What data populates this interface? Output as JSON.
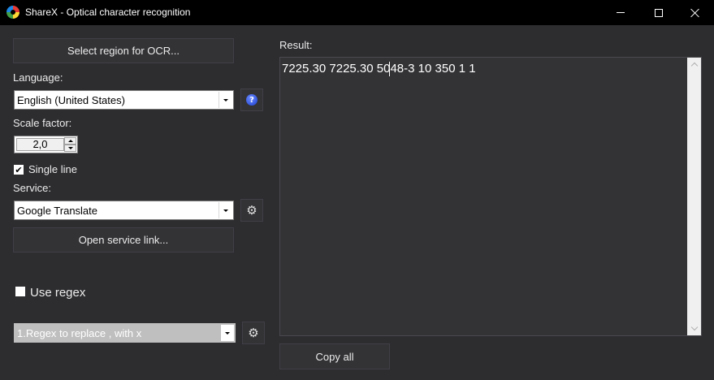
{
  "window": {
    "title": "ShareX - Optical character recognition",
    "icon": "sharex-logo-icon"
  },
  "left": {
    "select_region_label": "Select region for OCR...",
    "language_label": "Language:",
    "language_value": "English (United States)",
    "scale_label": "Scale factor:",
    "scale_value": "2,0",
    "single_line_label": "Single line",
    "single_line_checked": true,
    "service_label": "Service:",
    "service_value": "Google Translate",
    "open_service_label": "Open service link...",
    "use_regex_label": "Use regex",
    "use_regex_checked": false,
    "regex_value": "1.Regex to replace , with x"
  },
  "right": {
    "result_label": "Result:",
    "result_text": "7225.30 7225.30 5048-3 10 350 1 1",
    "copy_all_label": "Copy all"
  },
  "colors": {
    "background": "#2d2d30",
    "titlebar": "#000000",
    "button": "#333336",
    "text": "#ececec"
  }
}
